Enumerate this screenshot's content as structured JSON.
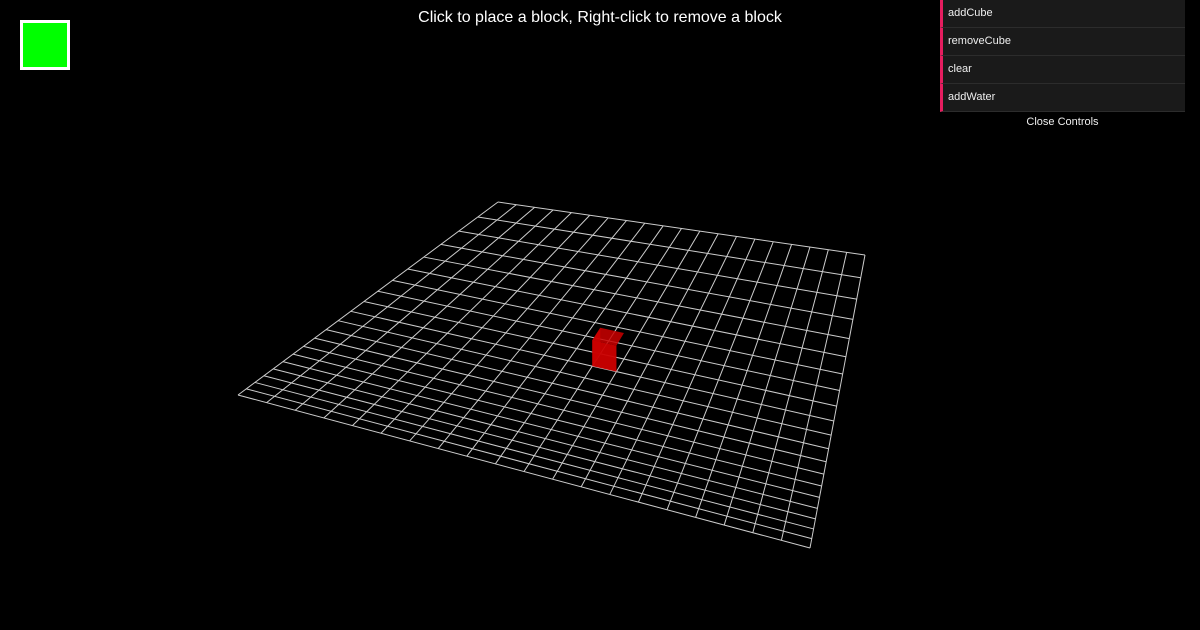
{
  "instructions": "Click to place a block, Right-click to remove a block",
  "selected_color": "#00ff00",
  "controls": {
    "items": [
      {
        "label": "addCube"
      },
      {
        "label": "removeCube"
      },
      {
        "label": "clear"
      },
      {
        "label": "addWater"
      }
    ],
    "close_label": "Close Controls",
    "accent_color": "#e61d5f"
  },
  "scene": {
    "grid_size": 20,
    "grid_color": "#cccccc",
    "placed_blocks": [
      {
        "col": 10,
        "row": 8,
        "color": "#cc0000"
      }
    ]
  }
}
